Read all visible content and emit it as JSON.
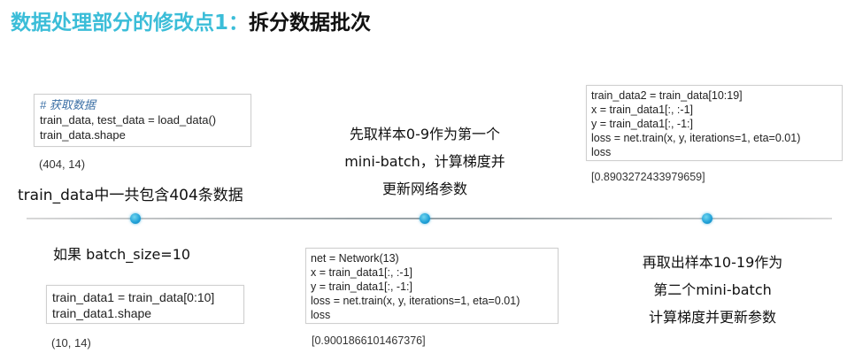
{
  "title": {
    "accent": "数据处理部分的修改点1：",
    "main": "拆分数据批次"
  },
  "block1": {
    "lines": [
      "# 获取数据",
      "train_data, test_data = load_data()",
      "train_data.shape"
    ],
    "output": "(404, 14)",
    "caption": "train_data中一共包含404条数据"
  },
  "block2": {
    "caption": "如果 batch_size=10",
    "lines": [
      "train_data1 = train_data[0:10]",
      "train_data1.shape"
    ],
    "output": "(10, 14)"
  },
  "middle": {
    "caption_lines": [
      "先取样本0-9作为第一个",
      "mini-batch，计算梯度并",
      "更新网络参数"
    ],
    "lines": [
      "net = Network(13)",
      "x = train_data1[:, :-1]",
      "y = train_data1[:, -1:]",
      "loss = net.train(x, y, iterations=1, eta=0.01)",
      "loss"
    ],
    "output": "[0.9001866101467376]"
  },
  "right": {
    "lines": [
      "train_data2 = train_data[10:19]",
      "x = train_data1[:, :-1]",
      "y = train_data1[:, -1:]",
      "loss = net.train(x, y, iterations=1, eta=0.01)",
      "loss"
    ],
    "output": "[0.8903272433979659]",
    "caption_lines": [
      "再取出样本10-19作为",
      "第二个mini-batch",
      "计算梯度并更新参数"
    ]
  }
}
